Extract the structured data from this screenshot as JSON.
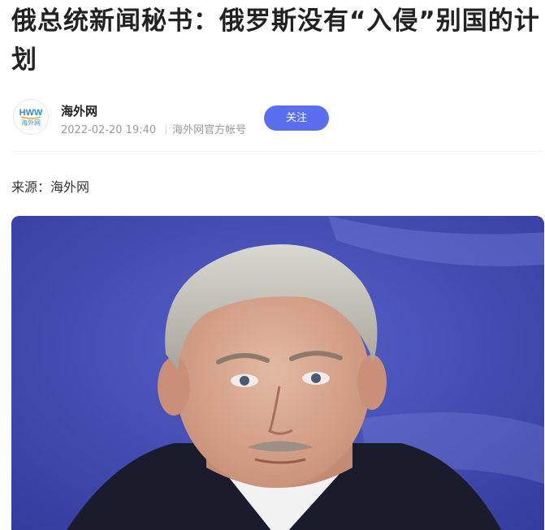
{
  "article": {
    "title": "俄总统新闻秘书：俄罗斯没有“入侵”别国的计划",
    "source_text": "来源：海外网"
  },
  "author": {
    "name": "海外网",
    "logo_text": "HWW",
    "logo_subtext": "海外网",
    "datetime": "2022-02-20 19:40",
    "account_type": "海外网官方帐号",
    "follow_label": "关注"
  },
  "colors": {
    "accent": "#5b6ef0",
    "photo_background": "#3f49b3"
  },
  "icons": {
    "avatar": "haiwainet-logo",
    "photo": "portrait-photo"
  }
}
